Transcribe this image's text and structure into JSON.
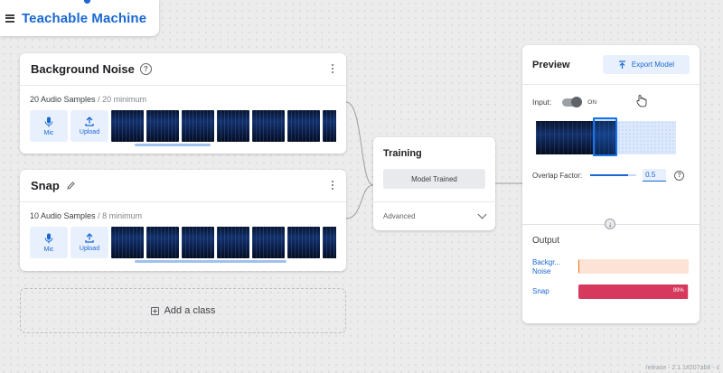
{
  "header": {
    "title": "Teachable Machine",
    "menu_icon": "hamburger-menu-icon"
  },
  "classes": [
    {
      "name": "Background Noise",
      "head_icon": "help-icon",
      "samples_count": "20 Audio Samples",
      "samples_min": " / 20 minimum",
      "mic_label": "Mic",
      "upload_label": "Upload",
      "scroll_position": 0.25
    },
    {
      "name": "Snap",
      "head_icon": "pencil-icon",
      "samples_count": "10 Audio Samples",
      "samples_min": " / 8 minimum",
      "mic_label": "Mic",
      "upload_label": "Upload",
      "scroll_position": 0.55
    }
  ],
  "add_class": {
    "label": "Add a class"
  },
  "training": {
    "title": "Training",
    "button_label": "Model Trained",
    "advanced_label": "Advanced"
  },
  "preview": {
    "title": "Preview",
    "export_label": "Export Model",
    "input_label": "Input:",
    "input_state": "ON",
    "overlap_label": "Overlap Factor:",
    "overlap_value": "0.5",
    "output_title": "Output",
    "outputs": [
      {
        "label_line1": "Backgr...",
        "label_line2": "Noise",
        "percent": 1,
        "percent_label": "",
        "fill": "#e8710a",
        "track": "#fde3d6"
      },
      {
        "label_line1": "Snap",
        "label_line2": "",
        "percent": 99,
        "percent_label": "99%",
        "fill": "#d7385e",
        "track": "#f8d4dd"
      }
    ]
  },
  "footer": {
    "release": "release - 2.1.1#207ab8 - s"
  },
  "colors": {
    "accent": "#1967d2",
    "background": "#ececec"
  }
}
